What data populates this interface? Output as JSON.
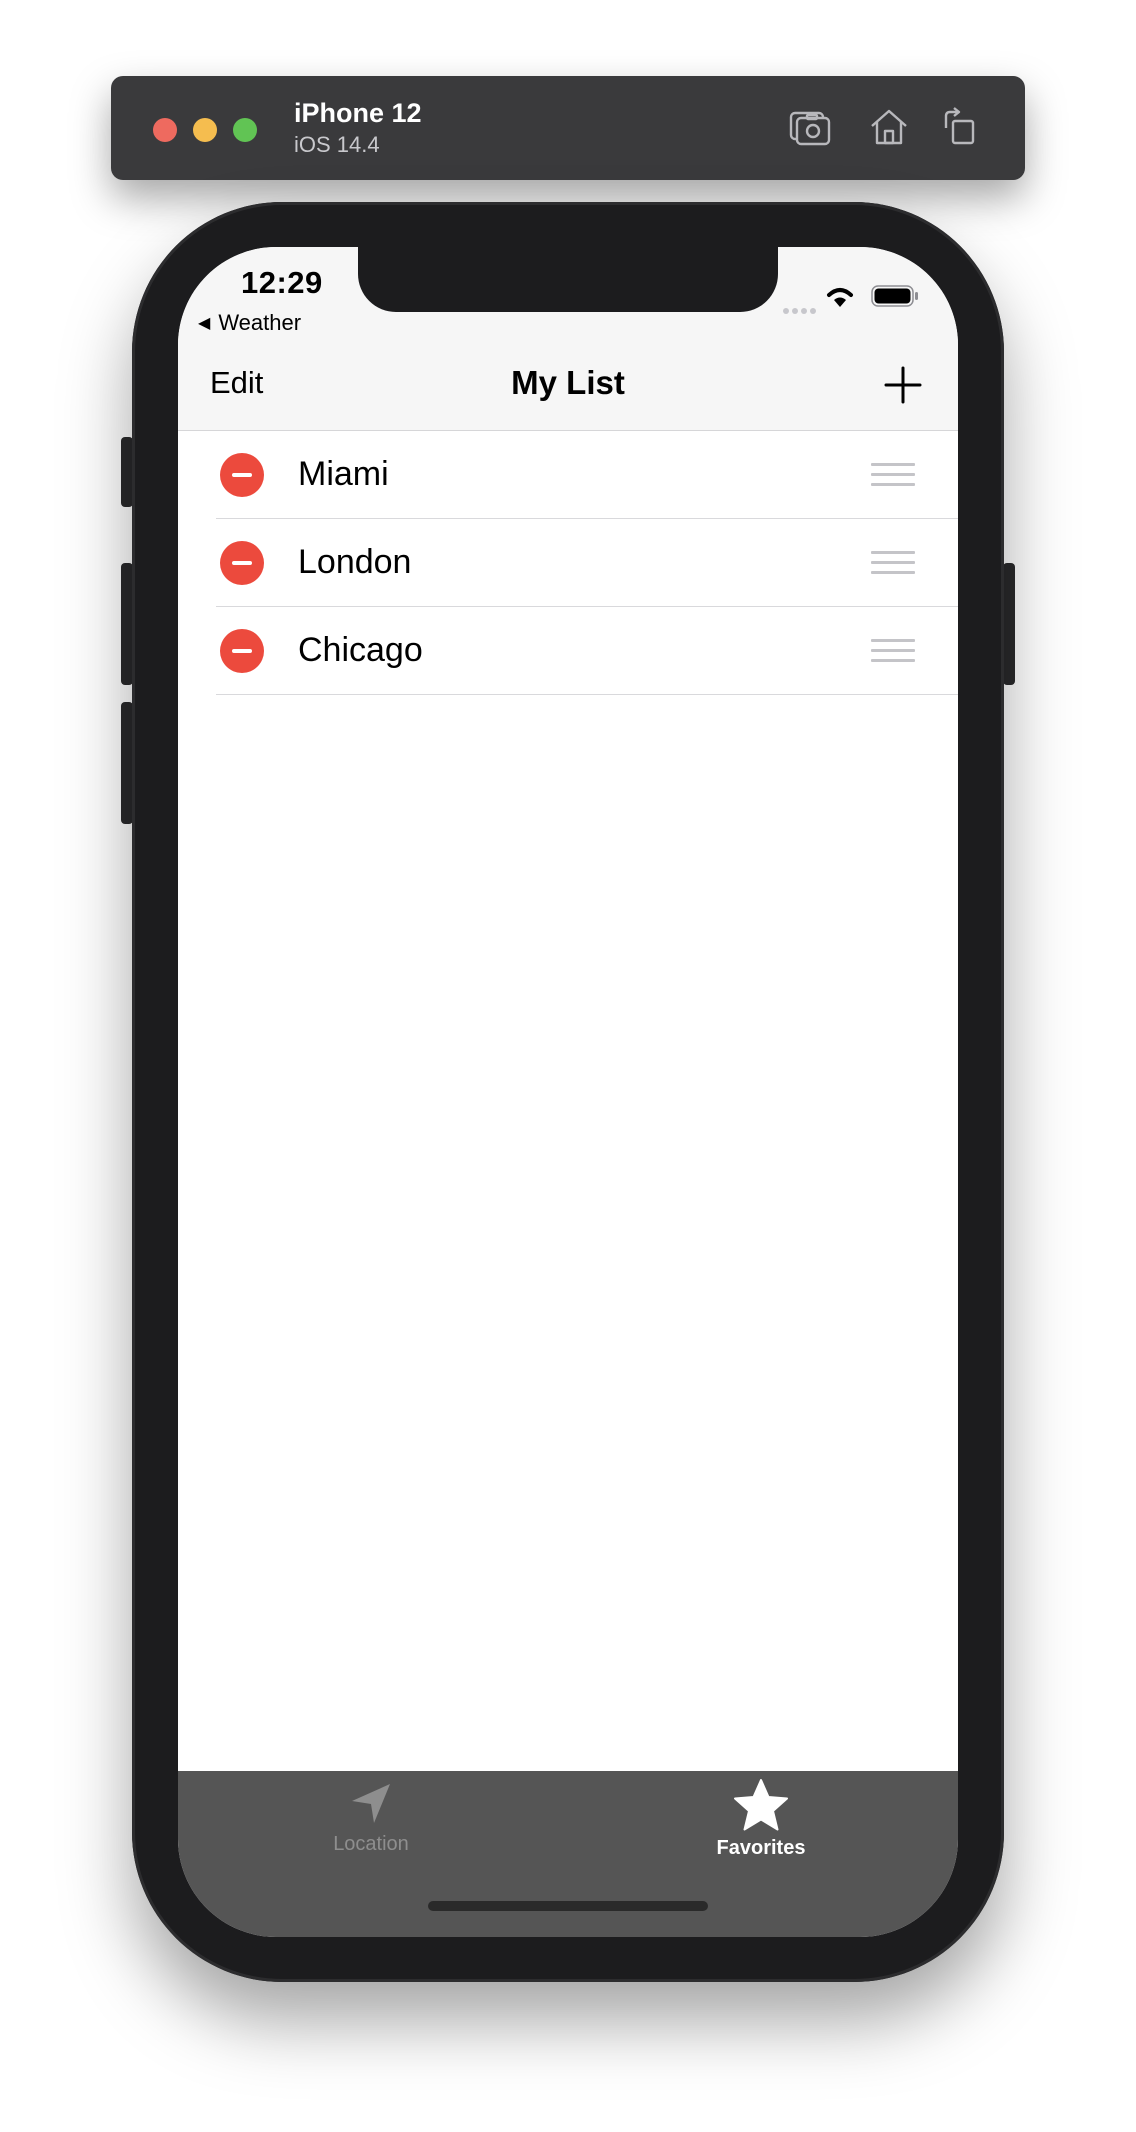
{
  "simulator": {
    "device_name": "iPhone 12",
    "os_version": "iOS 14.4",
    "controls": [
      "screenshot-icon",
      "home-icon",
      "rotate-icon"
    ]
  },
  "status_bar": {
    "time": "12:29",
    "back_app": "Weather"
  },
  "nav": {
    "edit_label": "Edit",
    "title": "My List",
    "add_icon": "plus-icon"
  },
  "cities": [
    {
      "name": "Miami"
    },
    {
      "name": "London"
    },
    {
      "name": "Chicago"
    }
  ],
  "tabs": [
    {
      "label": "Location",
      "icon": "location-arrow-icon",
      "selected": false
    },
    {
      "label": "Favorites",
      "icon": "star-icon",
      "selected": true
    }
  ],
  "colors": {
    "delete": "#ec4a3d",
    "tabbar": "#555555",
    "tab_inactive": "#8e8e8e",
    "tab_active": "#ffffff"
  }
}
